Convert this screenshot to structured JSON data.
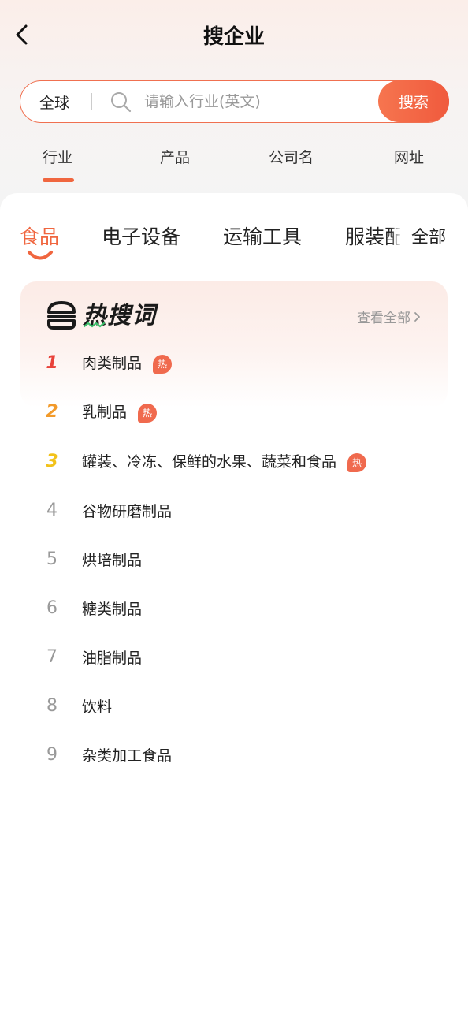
{
  "header": {
    "title": "搜企业"
  },
  "search": {
    "region": "全球",
    "placeholder": "请输入行业(英文)",
    "button_label": "搜索"
  },
  "tabs": [
    {
      "label": "行业",
      "active": true
    },
    {
      "label": "产品",
      "active": false
    },
    {
      "label": "公司名",
      "active": false
    },
    {
      "label": "网址",
      "active": false
    }
  ],
  "categories": [
    {
      "label": "食品",
      "active": true
    },
    {
      "label": "电子设备",
      "active": false
    },
    {
      "label": "运输工具",
      "active": false
    },
    {
      "label": "服装配",
      "active": false
    }
  ],
  "all_label": "全部",
  "hot": {
    "title": "热搜词",
    "view_all": "查看全部",
    "badge_text": "热",
    "items": [
      {
        "rank": "1",
        "label": "肉类制品",
        "hot": true
      },
      {
        "rank": "2",
        "label": "乳制品",
        "hot": true
      },
      {
        "rank": "3",
        "label": "罐装、冷冻、保鲜的水果、蔬菜和食品",
        "hot": true
      },
      {
        "rank": "4",
        "label": "谷物研磨制品",
        "hot": false
      },
      {
        "rank": "5",
        "label": "烘培制品",
        "hot": false
      },
      {
        "rank": "6",
        "label": "糖类制品",
        "hot": false
      },
      {
        "rank": "7",
        "label": "油脂制品",
        "hot": false
      },
      {
        "rank": "8",
        "label": "饮料",
        "hot": false
      },
      {
        "rank": "9",
        "label": "杂类加工食品",
        "hot": false
      }
    ]
  },
  "colors": {
    "accent": "#f0663f",
    "rank1": "#e8423a",
    "rank2": "#f29a2a",
    "rank3": "#f2c21a"
  }
}
